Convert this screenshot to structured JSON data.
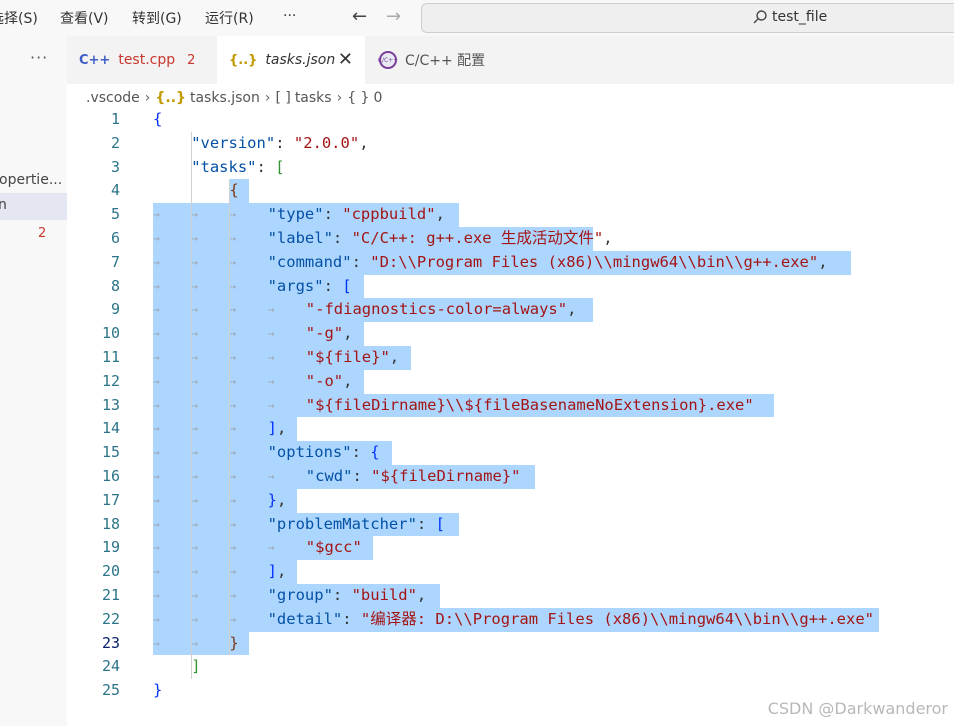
{
  "menu": {
    "items": [
      "选择(S)",
      "查看(V)",
      "转到(G)",
      "运行(R)"
    ],
    "more": "···",
    "back": "←",
    "forward": "→"
  },
  "search": {
    "text": "test_file"
  },
  "sidebar": {
    "more": "···",
    "item1": "opertie...",
    "item2": "n",
    "problem_count": "2"
  },
  "tabs": [
    {
      "icon": "C++",
      "label": "test.cpp",
      "badge": "2"
    },
    {
      "icon": "{..}",
      "label": "tasks.json",
      "close": "✕"
    },
    {
      "icon": "C/C++",
      "label": "C/C++ 配置"
    }
  ],
  "breadcrumb": {
    "folder": ".vscode",
    "file_icon": "{..}",
    "file": "tasks.json",
    "array_icon": "[ ]",
    "array": "tasks",
    "obj_icon": "{ }",
    "index": "0"
  },
  "editor": {
    "line_numbers": [
      "1",
      "2",
      "3",
      "4",
      "5",
      "6",
      "7",
      "8",
      "9",
      "10",
      "11",
      "12",
      "13",
      "14",
      "15",
      "16",
      "17",
      "18",
      "19",
      "20",
      "21",
      "22",
      "23",
      "24",
      "25"
    ],
    "current_line": 23,
    "version": "2.0.0",
    "type": "cppbuild",
    "label": "C/C++: g++.exe 生成活动文件",
    "command": "D:\\\\Program Files (x86)\\\\mingw64\\\\bin\\\\g++.exe",
    "args": [
      "-fdiagnostics-color=always",
      "-g",
      "${file}",
      "-o",
      "${fileDirname}\\\\${fileBasenameNoExtension}.exe"
    ],
    "cwd": "${fileDirname}",
    "problemMatcher": "$gcc",
    "group": "build",
    "detail": "编译器: D:\\\\Program Files (x86)\\\\mingw64\\\\bin\\\\g++.exe"
  },
  "watermark": "CSDN @Darkwanderor"
}
